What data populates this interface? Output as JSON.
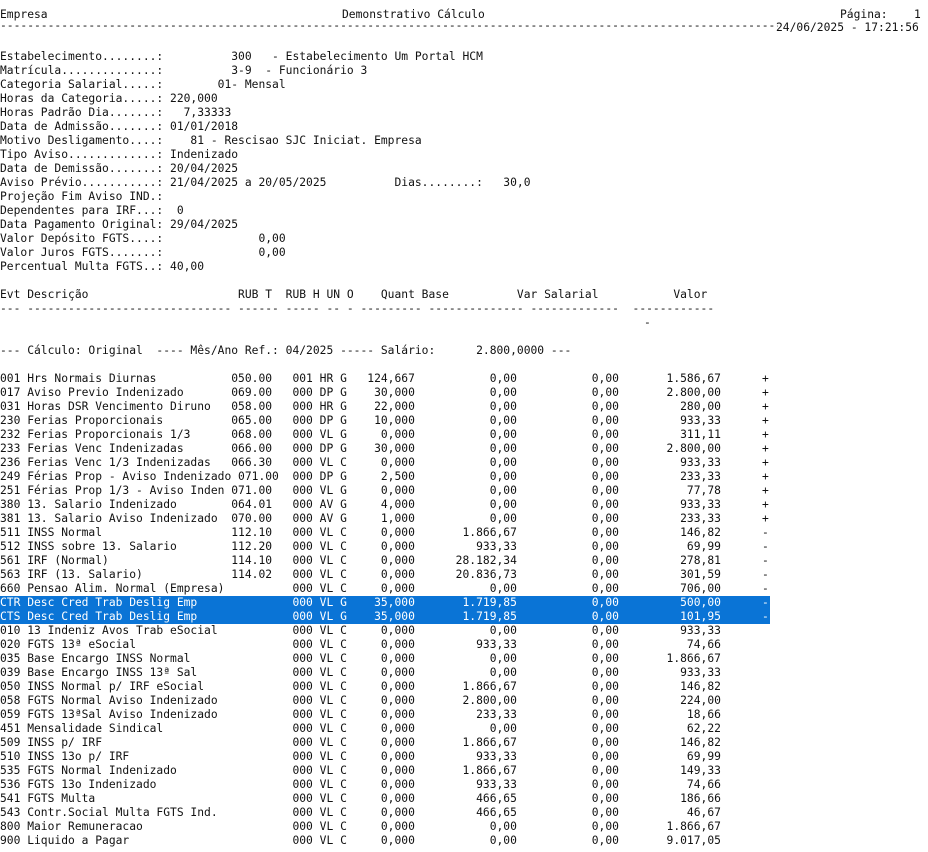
{
  "header": {
    "company_label": "Empresa",
    "report_title": "Demonstrativo Cálculo",
    "page_label": "Página:",
    "page_number": "1",
    "rule": "-----------------------------------------------------------------------------------------------------------------------------",
    "datetime": "24/06/2025 - 17:21:56"
  },
  "info": [
    "Estabelecimento........:          300   - Estabelecimento Um Portal HCM",
    "Matrícula..............:          3-9  - Funcionário 3",
    "Categoria Salarial.....:        01- Mensal",
    "Horas da Categoria.....: 220,000",
    "Horas Padrão Dia.......:   7,33333",
    "Data de Admissão.......: 01/01/2018",
    "Motivo Desligamento....:    81 - Rescisao SJC Iniciat. Empresa",
    "Tipo Aviso.............: Indenizado",
    "Data de Demissão.......: 20/04/2025",
    "Aviso Prévio...........: 21/04/2025 a 20/05/2025          Dias........:   30,0",
    "Projeção Fim Aviso IND.:",
    "Dependentes para IRF...:  0",
    "Data Pagamento Original: 29/04/2025",
    "Valor Depósito FGTS....:              0,00",
    "Valor Juros FGTS.......:              0,00",
    "Percentual Multa FGTS..: 40,00"
  ],
  "table": {
    "header_line": "Evt Descrição                      RUB T  RUB H UN O    Quant Base          Var Salarial           Valor",
    "dash_line": "--- ------------------------------ ------ ----- -- - --------- -------------- -------------  ------------",
    "dash_tail": "-",
    "calc_line": "--- Cálculo: Original  ---- Mês/Ano Ref.: 04/2025 ----- Salário:      2.800,0000 ---",
    "rows": [
      {
        "text": "001 Hrs Normais Diurnas           050.00   001 HR G   124,667           0,00           0,00       1.586,67",
        "mark": "+",
        "selected": false
      },
      {
        "text": "017 Aviso Previo Indenizado       069.00   000 DP G    30,000           0,00           0,00       2.800,00",
        "mark": "+",
        "selected": false
      },
      {
        "text": "031 Horas DSR Vencimento Diruno   058.00   000 HR G    22,000           0,00           0,00         280,00",
        "mark": "+",
        "selected": false
      },
      {
        "text": "230 Ferias Proporcionais          065.00   000 DP G    10,000           0,00           0,00         933,33",
        "mark": "+",
        "selected": false
      },
      {
        "text": "232 Ferias Proporcionais 1/3      068.00   000 VL G     0,000           0,00           0,00         311,11",
        "mark": "+",
        "selected": false
      },
      {
        "text": "233 Ferias Venc Indenizadas       066.00   000 DP G    30,000           0,00           0,00       2.800,00",
        "mark": "+",
        "selected": false
      },
      {
        "text": "236 Ferias Venc 1/3 Indenizadas   066.30   000 VL C     0,000           0,00           0,00         933,33",
        "mark": "+",
        "selected": false
      },
      {
        "text": "249 Férias Prop - Aviso Indenizado 071.00  000 DP G     2,500           0,00           0,00         233,33",
        "mark": "+",
        "selected": false
      },
      {
        "text": "251 Férias Prop 1/3 - Aviso Inden 071.00   000 VL G     0,000           0,00           0,00          77,78",
        "mark": "+",
        "selected": false
      },
      {
        "text": "380 13. Salario Indenizado        064.01   000 AV G     4,000           0,00           0,00         933,33",
        "mark": "+",
        "selected": false
      },
      {
        "text": "381 13. Salario Aviso Indenizado  070.00   000 AV G     1,000           0,00           0,00         233,33",
        "mark": "+",
        "selected": false
      },
      {
        "text": "511 INSS Normal                   112.10   000 VL C     0,000       1.866,67           0,00         146,82",
        "mark": "-",
        "selected": false
      },
      {
        "text": "512 INSS sobre 13. Salario        112.20   000 VL C     0,000         933,33           0,00          69,99",
        "mark": "-",
        "selected": false
      },
      {
        "text": "561 IRF (Normal)                  114.10   000 VL C     0,000      28.182,34           0,00         278,81",
        "mark": "-",
        "selected": false
      },
      {
        "text": "563 IRF (13. Salario)             114.02   000 VL C     0,000      20.836,73           0,00         301,59",
        "mark": "-",
        "selected": false
      },
      {
        "text": "660 Pensao Alim. Normal (Empresa)          000 VL C     0,000           0,00           0,00         706,00",
        "mark": "-",
        "selected": false
      },
      {
        "text": "CTR Desc Cred Trab Deslig Emp              000 VL G    35,000       1.719,85           0,00         500,00",
        "mark": "-",
        "selected": true
      },
      {
        "text": "CTS Desc Cred Trab Deslig Emp              000 VL G    35,000       1.719,85           0,00         101,95",
        "mark": "-",
        "selected": true
      },
      {
        "text": "010 13 Indeniz Avos Trab eSocial           000 VL C     0,000           0,00           0,00         933,33",
        "mark": "",
        "selected": false
      },
      {
        "text": "020 FGTS 13ª eSocial                       000 VL C     0,000         933,33           0,00          74,66",
        "mark": "",
        "selected": false
      },
      {
        "text": "035 Base Encargo INSS Normal               000 VL C     0,000           0,00           0,00       1.866,67",
        "mark": "",
        "selected": false
      },
      {
        "text": "039 Base Encargo INSS 13ª Sal              000 VL C     0,000           0,00           0,00         933,33",
        "mark": "",
        "selected": false
      },
      {
        "text": "050 INSS Normal p/ IRF eSocial             000 VL C     0,000       1.866,67           0,00         146,82",
        "mark": "",
        "selected": false
      },
      {
        "text": "058 FGTS Normal Aviso Indenizado           000 VL C     0,000       2.800,00           0,00         224,00",
        "mark": "",
        "selected": false
      },
      {
        "text": "059 FGTS 13ªSal Aviso Indenizado           000 VL C     0,000         233,33           0,00          18,66",
        "mark": "",
        "selected": false
      },
      {
        "text": "451 Mensalidade Sindical                   000 VL C     0,000           0,00           0,00          62,22",
        "mark": "",
        "selected": false
      },
      {
        "text": "509 INSS p/ IRF                            000 VL C     0,000       1.866,67           0,00         146,82",
        "mark": "",
        "selected": false
      },
      {
        "text": "510 INSS 13o p/ IRF                        000 VL C     0,000         933,33           0,00          69,99",
        "mark": "",
        "selected": false
      },
      {
        "text": "535 FGTS Normal Indenizado                 000 VL C     0,000       1.866,67           0,00         149,33",
        "mark": "",
        "selected": false
      },
      {
        "text": "536 FGTS 13o Indenizado                    000 VL C     0,000         933,33           0,00          74,66",
        "mark": "",
        "selected": false
      },
      {
        "text": "541 FGTS Multa                             000 VL C     0,000         466,65           0,00         186,66",
        "mark": "",
        "selected": false
      },
      {
        "text": "543 Contr.Social Multa FGTS Ind.           000 VL C     0,000         466,65           0,00          46,67",
        "mark": "",
        "selected": false
      },
      {
        "text": "800 Maior Remuneracao                      000 VL C     0,000           0,00           0,00       1.866,67",
        "mark": "",
        "selected": false
      },
      {
        "text": "900 Liquido a Pagar                        000 VL C     0,000           0,00           0,00       9.017,05",
        "mark": "",
        "selected": false
      }
    ]
  },
  "colors": {
    "selection": "#0a74d6",
    "selection_text": "#ffffff"
  }
}
